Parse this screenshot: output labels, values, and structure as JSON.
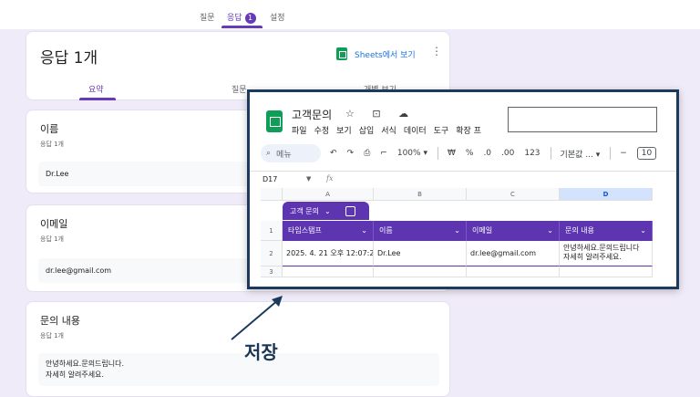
{
  "top_tabs": {
    "questions": "질문",
    "responses": "응답",
    "responses_badge": "1",
    "settings": "설정"
  },
  "summary": {
    "title": "응답 1개",
    "sheets_link": "Sheets에서 보기",
    "sub_tabs": {
      "summary": "요약",
      "question": "질문",
      "individual": "개별 보기"
    }
  },
  "question_cards": [
    {
      "title": "이름",
      "count": "응답 1개",
      "answer": "Dr.Lee"
    },
    {
      "title": "이메일",
      "count": "응답 1개",
      "answer": "dr.lee@gmail.com"
    },
    {
      "title": "문의 내용",
      "count": "응답 1개",
      "answer_lines": [
        "안녕하세요.문의드립니다.",
        "자세히 알려주세요."
      ]
    }
  ],
  "annotation": {
    "label": "저장"
  },
  "sheet": {
    "title": "고객문의",
    "title_icons": "☆ ⊡ ☁",
    "menu": [
      "파일",
      "수정",
      "보기",
      "삽입",
      "서식",
      "데이터",
      "도구",
      "확장 프"
    ],
    "toolbar": {
      "menu_search": "메뉴",
      "zoom": "100%",
      "currency": "₩",
      "percent": "%",
      "dec_decrease": ".0",
      "dec_increase": ".00",
      "number_format": "123",
      "font": "기본값 ...",
      "font_size": "10"
    },
    "cell_ref": "D17",
    "fx": "fx",
    "columns": [
      "A",
      "B",
      "C",
      "D"
    ],
    "rows": [
      "1",
      "2",
      "3"
    ],
    "table_name": "고객 문의",
    "headers": [
      "타임스탬프",
      "이름",
      "이메일",
      "문의 내용"
    ],
    "data_row": {
      "timestamp": "2025. 4. 21 오후 12:07:2",
      "name": "Dr.Lee",
      "email": "dr.lee@gmail.com",
      "inquiry_lines": [
        "안녕하세요.문의드립니다",
        "자세히 알려주세요."
      ]
    }
  }
}
